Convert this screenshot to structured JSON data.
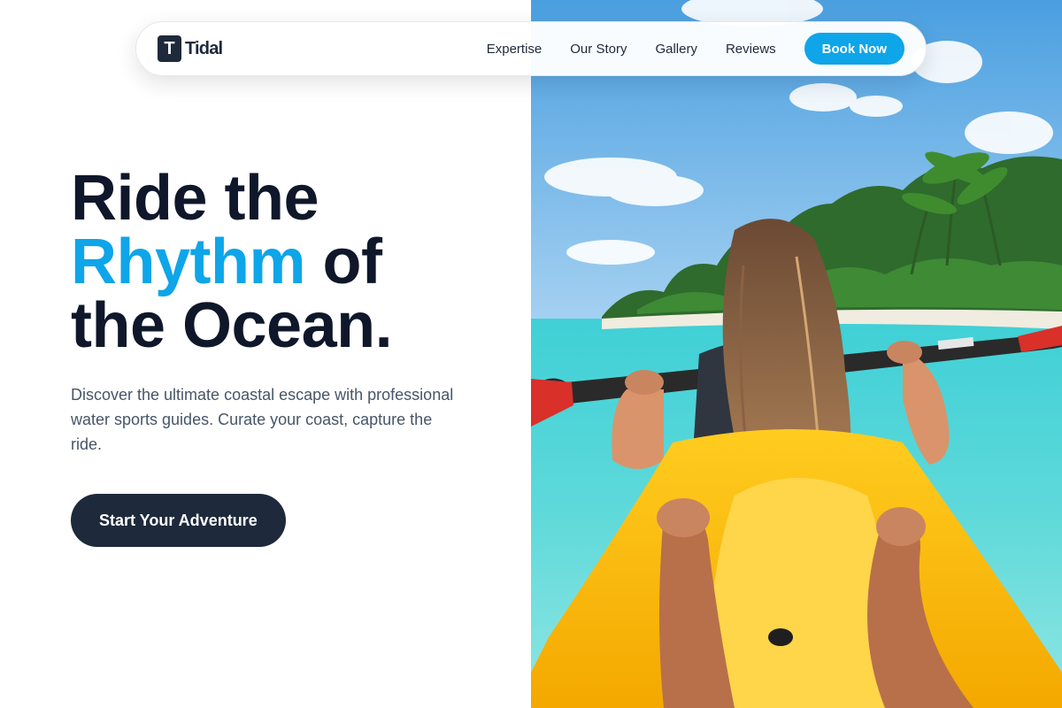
{
  "brand": {
    "mark": "T",
    "name": "Tidal"
  },
  "nav": {
    "links": [
      "Expertise",
      "Our Story",
      "Gallery",
      "Reviews"
    ],
    "cta_label": "Book Now"
  },
  "hero": {
    "headline_line1": "Ride the",
    "headline_accent": "Rhythm",
    "headline_line2_rest": " of",
    "headline_line3": "the Ocean.",
    "subcopy": "Discover the ultimate coastal escape with professional water sports guides. Curate your coast, capture the ride.",
    "cta_label": "Start Your Adventure",
    "image_alt": "Woman paddling a yellow kayak toward a tropical palm island over turquoise water"
  },
  "colors": {
    "accent": "#0ea5e9",
    "dark": "#1e293b",
    "heading": "#0f172a",
    "body": "#475569"
  }
}
